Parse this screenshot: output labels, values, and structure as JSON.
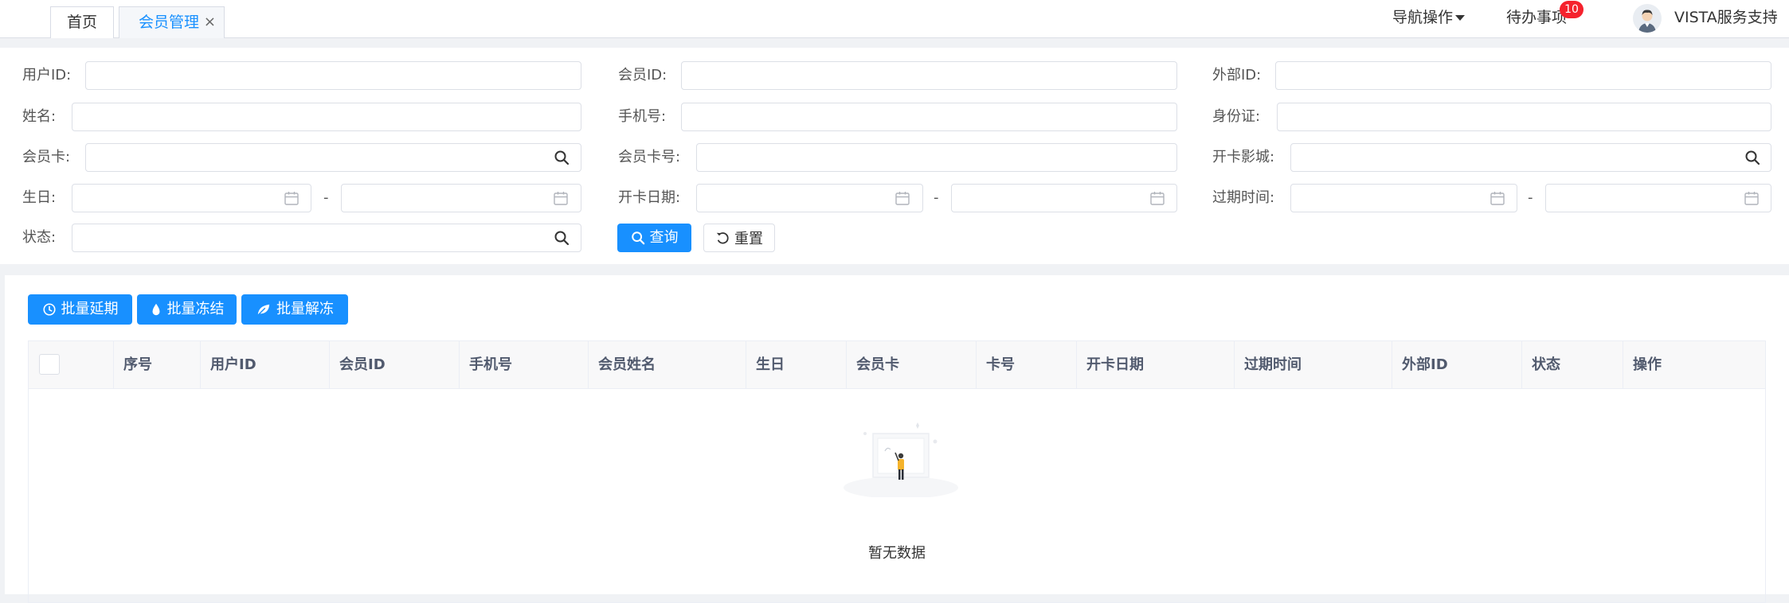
{
  "tabs": [
    {
      "label": "首页"
    },
    {
      "label": "会员管理",
      "close": "×"
    }
  ],
  "header": {
    "nav_ops": "导航操作",
    "todo": "待办事项",
    "todo_count": "10",
    "user": "VISTA服务支持"
  },
  "search": {
    "user_id": {
      "label": "用户ID:",
      "value": ""
    },
    "member_id": {
      "label": "会员ID:",
      "value": ""
    },
    "external_id": {
      "label": "外部ID:",
      "value": ""
    },
    "name": {
      "label": "姓名:",
      "value": ""
    },
    "phone": {
      "label": "手机号:",
      "value": ""
    },
    "id_card": {
      "label": "身份证:",
      "value": ""
    },
    "member_card": {
      "label": "会员卡:",
      "value": ""
    },
    "card_no": {
      "label": "会员卡号:",
      "value": ""
    },
    "cinema": {
      "label": "开卡影城:",
      "value": ""
    },
    "birthday": {
      "label": "生日:",
      "from": "",
      "to": ""
    },
    "open_date": {
      "label": "开卡日期:",
      "from": "",
      "to": ""
    },
    "expire": {
      "label": "过期时间:",
      "from": "",
      "to": ""
    },
    "status": {
      "label": "状态:",
      "value": ""
    },
    "range_sep": "-",
    "query_label": "查询",
    "reset_label": "重置"
  },
  "bulk": {
    "extend": "批量延期",
    "freeze": "批量冻结",
    "unfreeze": "批量解冻"
  },
  "table": {
    "columns": [
      "序号",
      "用户ID",
      "会员ID",
      "手机号",
      "会员姓名",
      "生日",
      "会员卡",
      "卡号",
      "开卡日期",
      "过期时间",
      "外部ID",
      "状态",
      "操作"
    ],
    "empty_text": "暂无数据"
  },
  "colors": {
    "primary": "#1890ff",
    "badge": "#f5222d"
  }
}
